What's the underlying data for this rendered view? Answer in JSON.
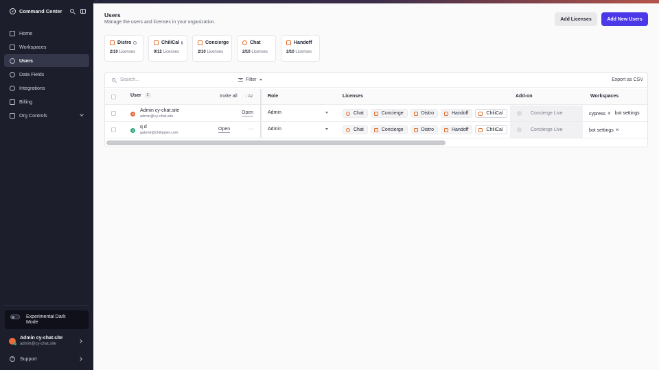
{
  "sidebar": {
    "brand": "Command Center",
    "items": [
      {
        "label": "Home",
        "icon": "home-icon"
      },
      {
        "label": "Workspaces",
        "icon": "workspaces-icon"
      },
      {
        "label": "Users",
        "icon": "users-icon"
      },
      {
        "label": "Data Fields",
        "icon": "data-fields-icon"
      },
      {
        "label": "Integrations",
        "icon": "integrations-icon"
      },
      {
        "label": "Billing",
        "icon": "billing-icon"
      },
      {
        "label": "Org Controls",
        "icon": "org-controls-icon"
      }
    ],
    "dark_mode_label": "Experimental Dark Mode",
    "account": {
      "name": "Admin cy-chat.site",
      "email": "admin@cy-chat.site"
    },
    "support_label": "Support"
  },
  "header": {
    "title": "Users",
    "subtitle": "Manage the users and licenses in your organization.",
    "add_licenses": "Add Licenses",
    "add_users": "Add New Users"
  },
  "license_cards": [
    {
      "name": "Distro",
      "used": "2/10",
      "unit": "Licenses",
      "info": true
    },
    {
      "name": "ChiliCal",
      "used": "0/12",
      "unit": "Licenses",
      "info": true
    },
    {
      "name": "Concierge",
      "used": "2/10",
      "unit": "Licenses",
      "info": false
    },
    {
      "name": "Chat",
      "used": "2/10",
      "unit": "Licenses",
      "info": false
    },
    {
      "name": "Handoff",
      "used": "2/10",
      "unit": "Licenses",
      "info": false
    }
  ],
  "table": {
    "search_placeholder": "Search...",
    "filter_label": "Filter",
    "export_label": "Export as CSV",
    "columns": {
      "user": "User",
      "user_count": "2",
      "invite_all": "Invite all",
      "sort": "↓ Az",
      "role": "Role",
      "licenses": "Licenses",
      "addon": "Add-on",
      "workspaces": "Workspaces"
    },
    "rows": [
      {
        "initial": "A",
        "name": "Admin cy-chat.site",
        "email": "admin@cy-chat.site",
        "action": "Open",
        "role": "Admin",
        "licenses": [
          "Chat",
          "Concierge",
          "Distro",
          "Handoff",
          "ChiliCal"
        ],
        "addon": "Concierge Live",
        "workspaces": [
          "cypress",
          "bot settings"
        ]
      },
      {
        "initial": "G",
        "name": "q d",
        "email": "gabriel@chilipiper.com",
        "action": "Open",
        "more": "···",
        "role": "Admin",
        "licenses": [
          "Chat",
          "Concierge",
          "Distro",
          "Handoff",
          "ChiliCal"
        ],
        "addon": "Concierge Live",
        "workspaces": [
          "bot settings"
        ]
      }
    ]
  },
  "colors": {
    "primary": "#4b38e8",
    "sidebar_bg": "#1c1e2b",
    "license_accent": "#e56a24"
  }
}
